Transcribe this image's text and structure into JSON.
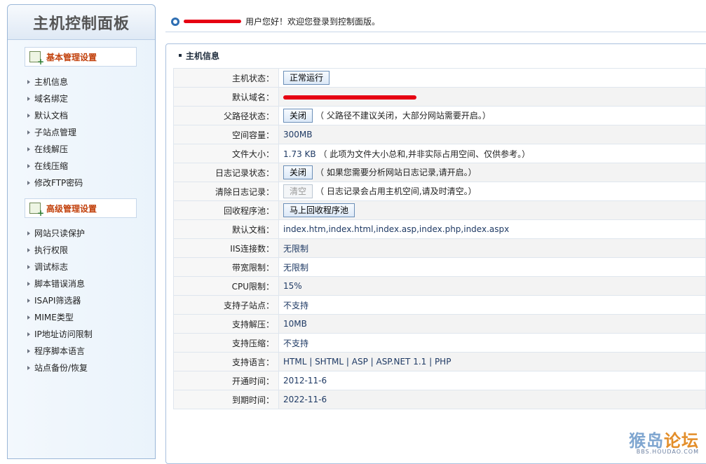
{
  "sidebar": {
    "title": "主机控制面板",
    "basic_section": "基本管理设置",
    "basic_items": [
      "主机信息",
      "域名绑定",
      "默认文档",
      "子站点管理",
      "在线解压",
      "在线压缩",
      "修改FTP密码"
    ],
    "advanced_section": "高级管理设置",
    "advanced_items": [
      "网站只读保护",
      "执行权限",
      "调试标志",
      "脚本错误消息",
      "ISAPI筛选器",
      "MIME类型",
      "IP地址访问限制",
      "程序脚本语言",
      "站点备份/恢复"
    ]
  },
  "topbar": {
    "welcome": "用户您好！欢迎您登录到控制面版。"
  },
  "panel": {
    "title": "主机信息",
    "rows": [
      {
        "label": "主机状态：",
        "button": "正常运行"
      },
      {
        "label": "默认域名："
      },
      {
        "label": "父路径状态：",
        "button": "关闭",
        "note": "（ 父路径不建议关闭，大部分网站需要开启。）"
      },
      {
        "label": "空间容量：",
        "value": "300MB"
      },
      {
        "label": "文件大小：",
        "value": "1.73 KB",
        "note": "（ 此项为文件大小总和,并非实际占用空间、仅供参考。）"
      },
      {
        "label": "日志记录状态：",
        "button": "关闭",
        "note": "（ 如果您需要分析网站日志记录,请开启。）"
      },
      {
        "label": "清除日志记录：",
        "button": "清空",
        "note": "（ 日志记录会占用主机空间,请及时清空。）"
      },
      {
        "label": "回收程序池：",
        "button": "马上回收程序池"
      },
      {
        "label": "默认文档：",
        "value": "index.htm,index.html,index.asp,index.php,index.aspx"
      },
      {
        "label": "IIS连接数：",
        "value": "无限制"
      },
      {
        "label": "带宽限制：",
        "value": "无限制"
      },
      {
        "label": "CPU限制：",
        "value": "15%"
      },
      {
        "label": "支持子站点：",
        "value": "不支持"
      },
      {
        "label": "支持解压：",
        "value": "10MB"
      },
      {
        "label": "支持压缩：",
        "value": "不支持"
      },
      {
        "label": "支持语言：",
        "value": "HTML | SHTML | ASP | ASP.NET 1.1 | PHP"
      },
      {
        "label": "开通时间：",
        "value": "2012-11-6"
      },
      {
        "label": "到期时间：",
        "value": "2022-11-6"
      }
    ]
  },
  "watermark": {
    "main_a": "猴岛",
    "main_b": "论坛",
    "sub": "BBS.HOUDAO.COM"
  }
}
